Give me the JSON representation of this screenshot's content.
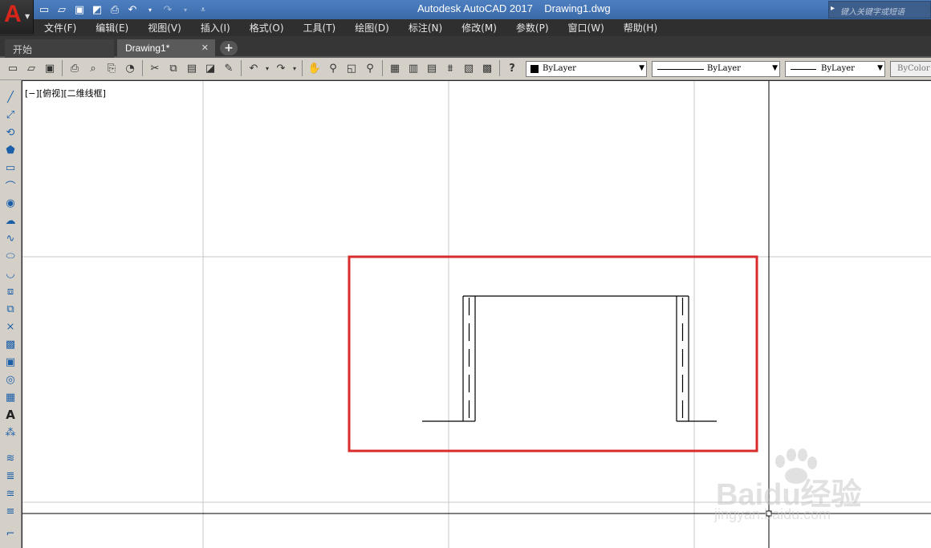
{
  "window": {
    "title": "Autodesk AutoCAD 2017    Drawing1.dwg",
    "search_placeholder": "键入关键字或短语"
  },
  "app_button": {
    "letter": "A"
  },
  "menu": {
    "items": [
      "文件(F)",
      "编辑(E)",
      "视图(V)",
      "插入(I)",
      "格式(O)",
      "工具(T)",
      "绘图(D)",
      "标注(N)",
      "修改(M)",
      "参数(P)",
      "窗口(W)",
      "帮助(H)"
    ]
  },
  "tabs": {
    "start": "开始",
    "drawing": "Drawing1*",
    "close_glyph": "✕",
    "add_glyph": "+"
  },
  "toolbar": {
    "color_value": "ByLayer",
    "linetype_value": "ByLayer",
    "lineweight_value": "ByLayer",
    "plotstyle_value": "ByColor"
  },
  "viewport": {
    "label": "[−][俯视][二维线框]"
  },
  "watermark": {
    "brand": "Baidu经验",
    "url": "jingyan.baidu.com"
  },
  "colors": {
    "highlight_box": "#d92b2b",
    "grid": "#c8c8c8",
    "axis": "#000000",
    "title_bar": "#4472b0"
  },
  "icons": {
    "left_toolbar": [
      "line-icon",
      "construction-line-icon",
      "polyline-icon",
      "polygon-icon",
      "rectangle-icon",
      "arc-icon",
      "circle-icon",
      "revcloud-icon",
      "spline-icon",
      "ellipse-icon",
      "ellipse-arc-icon",
      "insert-block-icon",
      "make-block-icon",
      "point-icon",
      "hatch-icon",
      "gradient-icon",
      "region-icon",
      "table-icon",
      "mtext-icon",
      "add-selected-icon",
      "layer-icon",
      "layer-match-icon",
      "layer-previous-icon",
      "layer-iso-icon",
      "fillet-icon"
    ]
  }
}
